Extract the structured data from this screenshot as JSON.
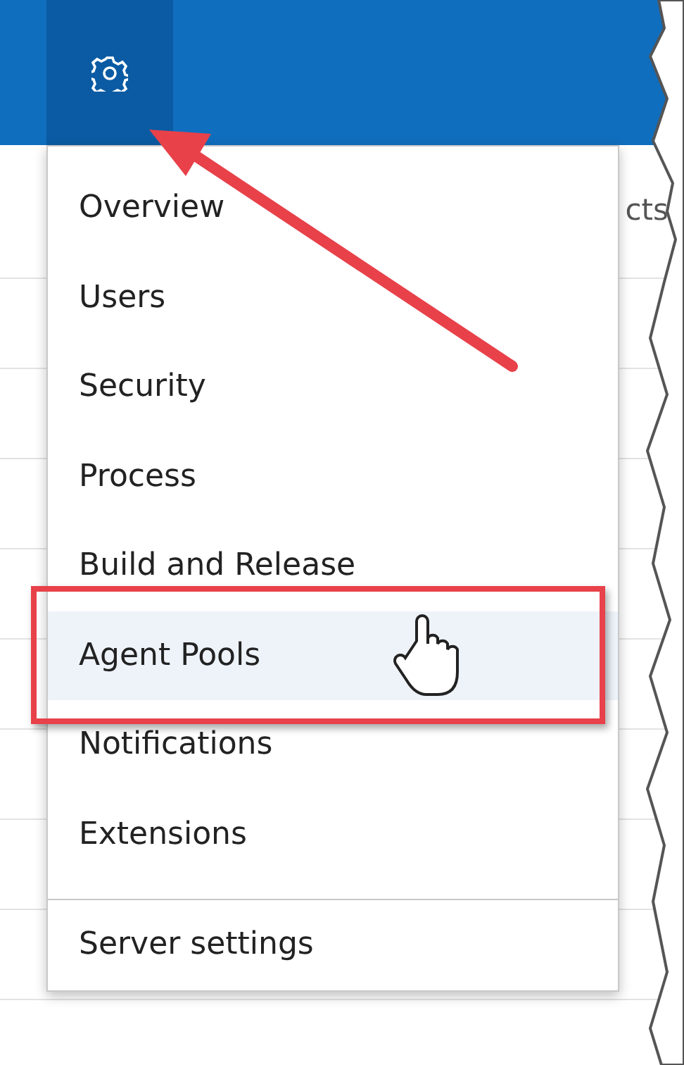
{
  "header": {
    "settings_button": {
      "selected": true
    }
  },
  "background": {
    "column_text": "cts"
  },
  "menu": {
    "items": [
      {
        "label": "Overview",
        "selected": false
      },
      {
        "label": "Users",
        "selected": false
      },
      {
        "label": "Security",
        "selected": false
      },
      {
        "label": "Process",
        "selected": false
      },
      {
        "label": "Build and Release",
        "selected": false
      },
      {
        "label": "Agent Pools",
        "selected": true
      },
      {
        "label": "Notifications",
        "selected": false
      },
      {
        "label": "Extensions",
        "selected": false
      }
    ],
    "footer_items": [
      {
        "label": "Server settings",
        "selected": false
      }
    ]
  }
}
